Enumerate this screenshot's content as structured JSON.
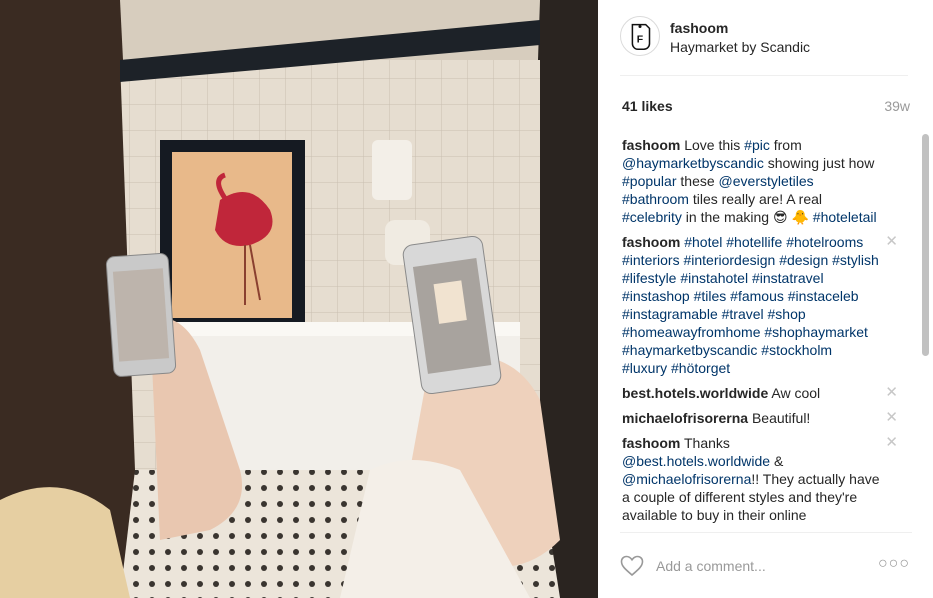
{
  "post": {
    "owner": "fashoom",
    "location": "Haymarket by Scandic",
    "likes": "41 likes",
    "age": "39w"
  },
  "comments": [
    {
      "user": "fashoom",
      "parts": [
        {
          "t": "text",
          "v": " Love this "
        },
        {
          "t": "tag",
          "v": "#pic"
        },
        {
          "t": "text",
          "v": " from "
        },
        {
          "t": "tag",
          "v": "@haymarketbyscandic"
        },
        {
          "t": "text",
          "v": " showing just how "
        },
        {
          "t": "tag",
          "v": "#popular"
        },
        {
          "t": "text",
          "v": " these "
        },
        {
          "t": "tag",
          "v": "@everstyletiles"
        },
        {
          "t": "text",
          "v": " "
        },
        {
          "t": "tag",
          "v": "#bathroom"
        },
        {
          "t": "text",
          "v": " tiles really are! A real "
        },
        {
          "t": "tag",
          "v": "#celebrity"
        },
        {
          "t": "text",
          "v": " in the making 😎 🐥 "
        },
        {
          "t": "tag",
          "v": "#hoteletail"
        }
      ],
      "deletable": false
    },
    {
      "user": "fashoom",
      "parts": [
        {
          "t": "text",
          "v": " "
        },
        {
          "t": "tag",
          "v": "#hotel #hotellife #hotelrooms #interiors #interiordesign #design #stylish #lifestyle #instahotel #instatravel #instashop #tiles #famous #instaceleb #instagramable #travel #shop #homeawayfromhome #shophaymarket #haymarketbyscandic #stockholm #luxury #hötorget"
        }
      ],
      "deletable": true
    },
    {
      "user": "best.hotels.worldwide",
      "parts": [
        {
          "t": "text",
          "v": " Aw cool"
        }
      ],
      "deletable": true
    },
    {
      "user": "michaelofrisorerna",
      "parts": [
        {
          "t": "text",
          "v": " Beautiful!"
        }
      ],
      "deletable": true
    },
    {
      "user": "fashoom",
      "parts": [
        {
          "t": "text",
          "v": " Thanks "
        },
        {
          "t": "tag",
          "v": "@best.hotels.worldwide"
        },
        {
          "t": "text",
          "v": " & "
        },
        {
          "t": "tag",
          "v": "@michaelofrisorerna"
        },
        {
          "t": "text",
          "v": "!! They actually have a couple of different styles and they're available to buy in their online"
        }
      ],
      "deletable": true
    }
  ],
  "delete_icon": "close-icon",
  "delete_glyph": "✕",
  "composer": {
    "placeholder": "Add a comment...",
    "more_glyph": "○○○"
  },
  "colors": {
    "link": "#003569",
    "muted": "#999999",
    "text": "#262626"
  }
}
